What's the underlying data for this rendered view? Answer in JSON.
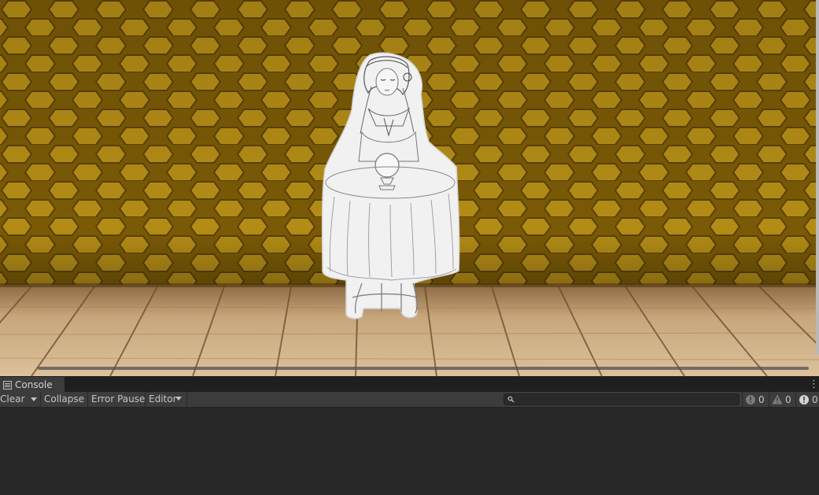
{
  "console": {
    "tab_label": "Console",
    "tab_icon": "console-list-icon",
    "menu_icon": "kebab-menu-icon",
    "toolbar": {
      "clear_label": "Clear",
      "collapse_label": "Collapse",
      "error_pause_label": "Error Pause",
      "editor_label": "Editor"
    },
    "search": {
      "value": "",
      "placeholder": ""
    },
    "counts": {
      "info": "0",
      "warnings": "0",
      "errors": "0"
    },
    "log_entries": []
  },
  "game_view": {
    "wall_color": "#8a6a0c",
    "floor_color": "#c2a27a",
    "figure": "sketch-of-fortune-teller-with-crystal-ball"
  }
}
